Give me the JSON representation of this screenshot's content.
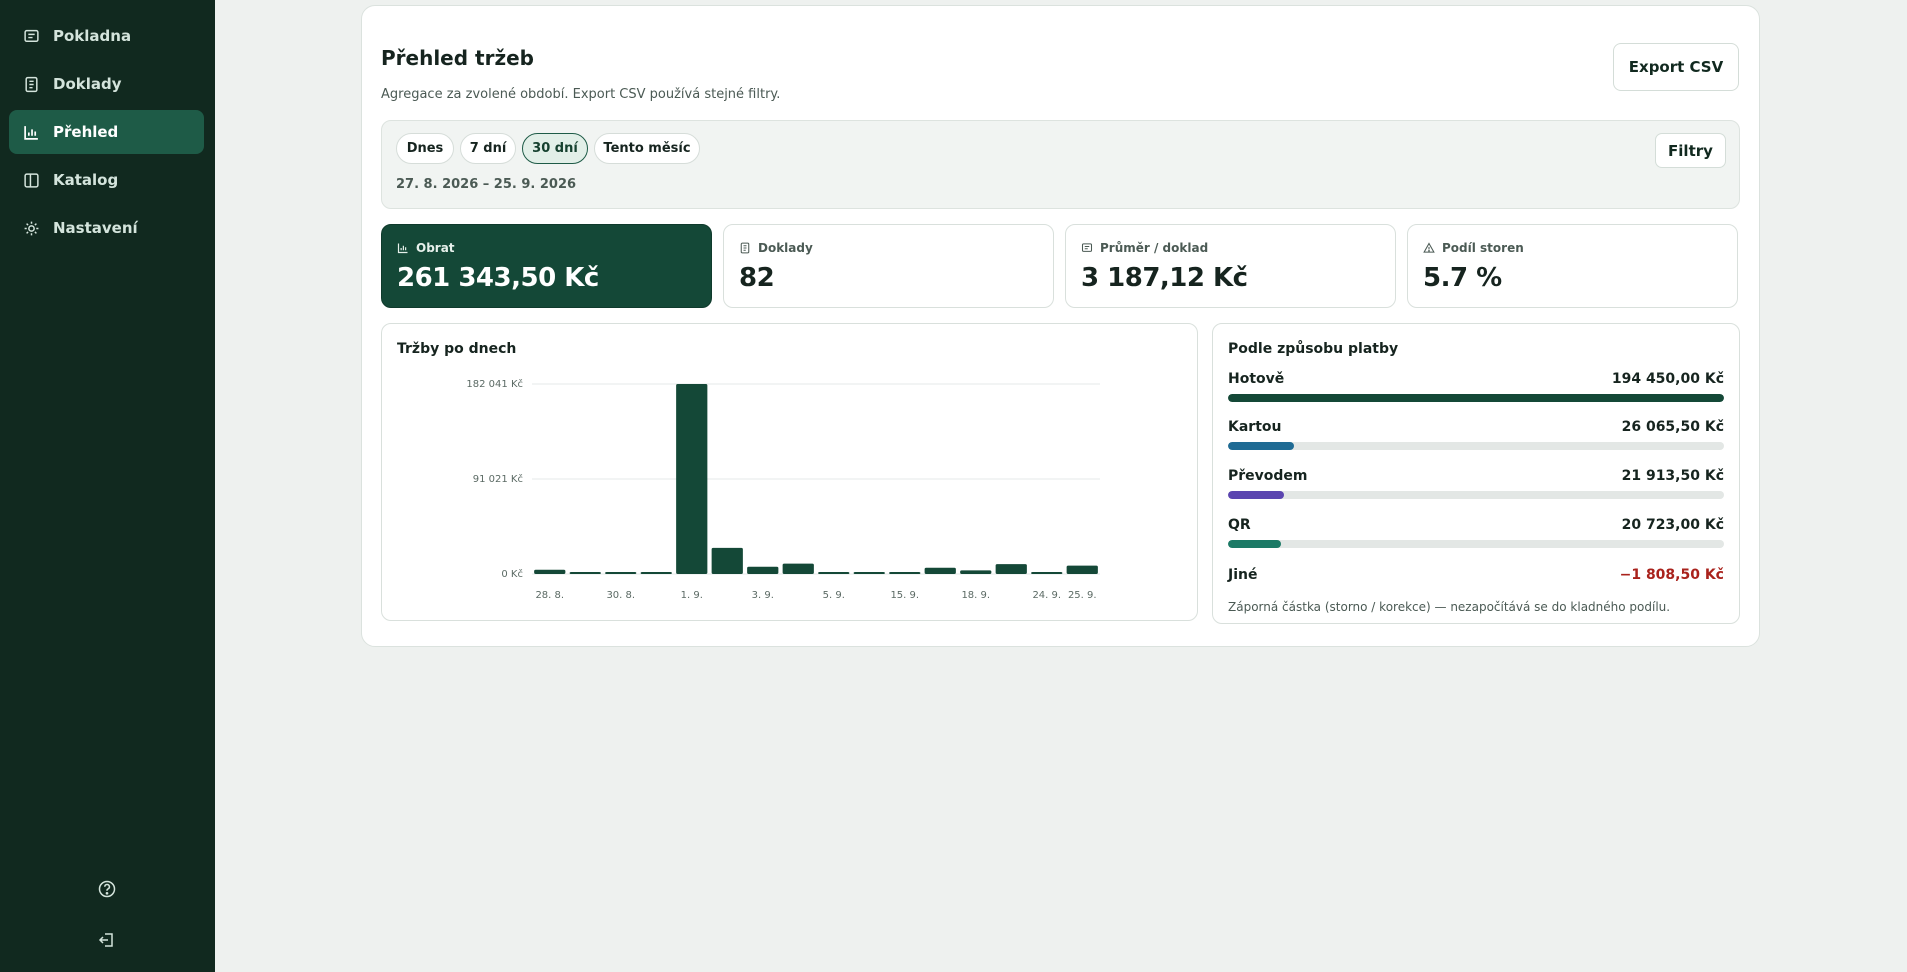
{
  "sidebar": {
    "items": [
      {
        "label": "Pokladna",
        "icon": "receipt-icon",
        "active": false
      },
      {
        "label": "Doklady",
        "icon": "document-icon",
        "active": false
      },
      {
        "label": "Přehled",
        "icon": "bar-chart-icon",
        "active": true
      },
      {
        "label": "Katalog",
        "icon": "book-icon",
        "active": false
      },
      {
        "label": "Nastavení",
        "icon": "gear-icon",
        "active": false
      }
    ],
    "bottom_icons": [
      "help-icon",
      "logout-icon"
    ]
  },
  "header": {
    "title": "Přehled tržeb",
    "subtitle": "Agregace za zvolené období. Export CSV používá stejné filtry.",
    "export_label": "Export CSV"
  },
  "filters": {
    "presets": [
      "Dnes",
      "7 dní",
      "30 dní",
      "Tento měsíc"
    ],
    "active_preset": "30 dní",
    "date_range": "27. 8. 2026 – 25. 9. 2026",
    "filters_label": "Filtry"
  },
  "kpis": [
    {
      "label": "Obrat",
      "value": "261 343,50 Kč",
      "icon": "bar-chart-icon"
    },
    {
      "label": "Doklady",
      "value": "82",
      "icon": "document-icon"
    },
    {
      "label": "Průměr / doklad",
      "value": "3 187,12 Kč",
      "icon": "receipt-icon"
    },
    {
      "label": "Podíl storen",
      "value": "5.7 %",
      "icon": "warning-icon"
    }
  ],
  "chart_data": {
    "type": "bar",
    "title": "Tržby po dnech",
    "categories": [
      "28. 8.",
      "29. 8.",
      "30. 8.",
      "31. 8.",
      "1. 9.",
      "2. 9.",
      "3. 9.",
      "4. 9.",
      "5. 9.",
      "14. 9.",
      "15. 9.",
      "16. 9.",
      "18. 9.",
      "19. 9.",
      "24. 9.",
      "25. 9."
    ],
    "values": [
      4100,
      1000,
      1200,
      900,
      182041,
      25000,
      7000,
      10000,
      1200,
      1000,
      1200,
      6000,
      3500,
      9500,
      1200,
      8000
    ],
    "x_tick_labels": [
      "28. 8.",
      "30. 8.",
      "1. 9.",
      "3. 9.",
      "5. 9.",
      "15. 9.",
      "18. 9.",
      "24. 9.",
      "25. 9."
    ],
    "y_tick_labels": [
      "0 Kč",
      "91 021 Kč",
      "182 041 Kč"
    ],
    "ylim": [
      0,
      182041
    ],
    "bar_color": "#144837",
    "grid": true
  },
  "payments": {
    "title": "Podle způsobu platby",
    "rows": [
      {
        "label": "Hotově",
        "amount": "194 450,00 Kč",
        "share": 1.0,
        "color": "#144837",
        "negative": false
      },
      {
        "label": "Kartou",
        "amount": "26 065,50 Kč",
        "share": 0.134,
        "color": "#1f6b94",
        "negative": false
      },
      {
        "label": "Převodem",
        "amount": "21 913,50 Kč",
        "share": 0.113,
        "color": "#5b45b0",
        "negative": false
      },
      {
        "label": "QR",
        "amount": "20 723,00 Kč",
        "share": 0.107,
        "color": "#1c7a66",
        "negative": false
      },
      {
        "label": "Jiné",
        "amount": "−1 808,50 Kč",
        "share": 0,
        "color": "#a9221c",
        "negative": true
      }
    ],
    "note": "Záporná částka (storno / korekce) — nezapočítává se do kladného podílu."
  }
}
